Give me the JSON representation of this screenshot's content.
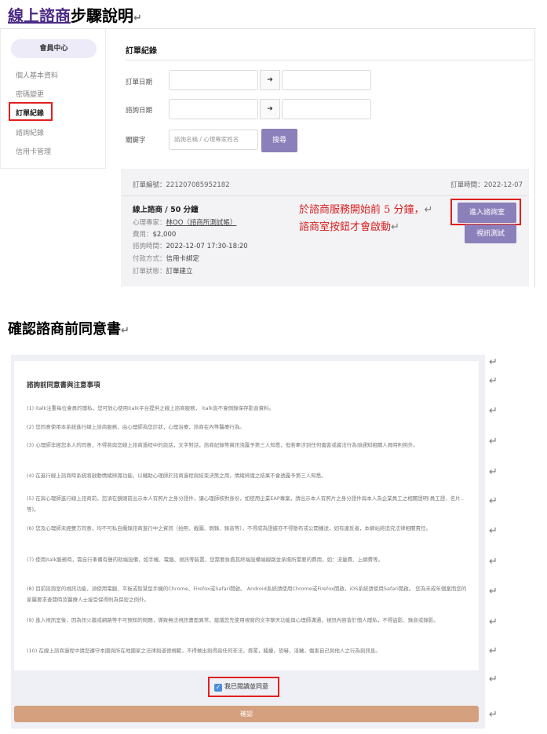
{
  "heading1": {
    "link": "線上諮商",
    "rest": "步驟說明"
  },
  "sidebar": {
    "member_center": "會員中心",
    "items": [
      {
        "label": "個人基本資料"
      },
      {
        "label": "密碼變更"
      },
      {
        "label": "訂單紀錄"
      },
      {
        "label": "諮詢紀錄"
      },
      {
        "label": "信用卡管理"
      }
    ]
  },
  "orders": {
    "section_title": "訂單紀錄",
    "filter": {
      "order_date_label": "訂單日期",
      "consult_date_label": "諮詢日期",
      "keyword_label": "關鍵字",
      "keyword_placeholder": "諮詢名稱 / 心理專家姓名",
      "range_arrow": "➜",
      "search_label": "搜尋"
    },
    "card": {
      "order_no": "訂單編號：221207085952182",
      "order_time": "訂單時間：2022-12-07",
      "title": "線上諮商 / 50 分鐘",
      "expert_label": "心理專家：",
      "expert_value": "林OO（諮商所測試帳）",
      "fee_label": "費用：",
      "fee_value": "$2,000",
      "consult_time_label": "諮詢時間：",
      "consult_time_value": "2022-12-07 17:30-18:20",
      "payment_label": "付款方式：",
      "payment_value": "信用卡綁定",
      "status_label": "訂單狀態：",
      "status_value": "訂單建立",
      "enter_room_label": "進入諮詢室",
      "video_test_label": "視訊測試"
    }
  },
  "annotation": {
    "line1": "於諮商服務開始前 5 分鐘，",
    "line2": "諮商室按鈕才會啟動"
  },
  "heading2": "確認諮商前同意書",
  "consent": {
    "title": "諮詢前同意書與注意事項",
    "paragraphs": [
      "(1) italk注重每位會員的隱私，您可放心使用italk平台提供之線上諮商服務， italk皆不會側錄保存影音資料。",
      "(2) 您同意使用本系統進行線上諮商服務，由心理師為您診狀，心理治療，諮商在內等醫療行為。",
      "(3) 心理師非經您本人的同意，不得將與您線上諮商過程中的談話，文字對話，諮商紀錄等資訊洩露予第三人知悉，但若牽涉到任何傷害或據法行為須通知相關人員時則例外。",
      "(4) 在進行線上諮商時系統將啟動情緒辨識功能，以輔助心理師於諮商過程與結束決策之用，情緒辨識之結果不會透露予第三人知悉。",
      "(5) 在與心理師進行線上諮商前，您須在鏡頭前出示本人有照片之身分證件，讓心理師核對身份，如使用企業EAP專案，請出示本人有照片之身分證件與本人為企業員工之相關證明(員工證、名片..等)。",
      "(6) 您及心理師未經雙方同意，均不可私自攝錄諮商進行中之資訊（拍照、截圖、側錄、錄音等），不得成為證據亦不得散布或公開播送，如有違反者，本網站將追究法律相關責任。",
      "(7) 使用italk服務時，需自行準備有聲的就端設備，如手機、電腦、視訊等裝置，您需要負擔其終端設備端線路並承擔所需要的費用，如：流量費、上網費等。",
      "(8) 目前諮詢室的視訊功能，須使用電腦、平板或智慧型手機的Chrome、Firefox或Safari開啟。 Android系統請使用Chrome或Firefox開啟，iOS系統請使用Safari開啟。 您為未成年個案而您的家屬要求查閱時及醫療人士接受保得則為保密之例外。",
      "(9) 進入視訊室後，因為訊火牆或網路等不可預知的問題，導致無法視訊畫面異常，建議您先使用視窗的文字聊天功能與心理師溝通，視訊內容皆於個人隱私，不得盜影、錄音或錄影。",
      "(10) 在線上諮商過程中請您遵守本國與所在地國家之法律與道德規範，不得做出與得惡任何非法，辱罵，騷擾，恐嚇，淫穢，傷害自己與他人之行為與訊息。"
    ],
    "agree_label": "我已閱讀並同意",
    "confirm_label": "確認"
  },
  "return_mark": "↵"
}
